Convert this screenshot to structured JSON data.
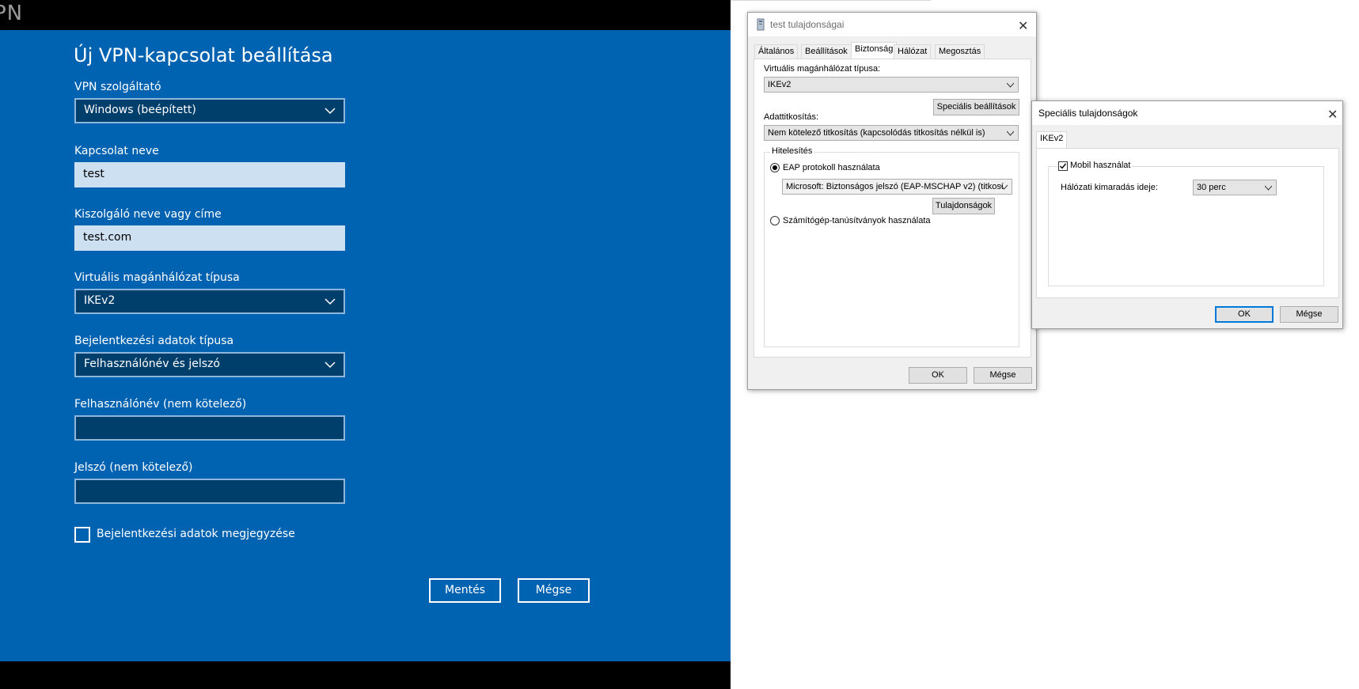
{
  "vpn": {
    "top_label": "PN",
    "title": "Új VPN-kapcsolat beállítása",
    "provider_label": "VPN szolgáltató",
    "provider_value": "Windows (beépített)",
    "connection_name_label": "Kapcsolat neve",
    "connection_name_value": "test",
    "server_label": "Kiszolgáló neve vagy címe",
    "server_value": "test.com",
    "vpn_type_label": "Virtuális magánhálózat típusa",
    "vpn_type_value": "IKEv2",
    "signin_type_label": "Bejelentkezési adatok típusa",
    "signin_type_value": "Felhasználónév és jelszó",
    "username_label": "Felhasználónév (nem kötelező)",
    "username_value": "",
    "password_label": "Jelszó (nem kötelező)",
    "password_value": "",
    "remember_label": "Bejelentkezési adatok megjegyzése",
    "remember_checked": false,
    "save_label": "Mentés",
    "cancel_label": "Mégse"
  },
  "props": {
    "title": "test tulajdonságai",
    "close_glyph": "✕",
    "tabs": [
      "Általános",
      "Beállítások",
      "Biztonság",
      "Hálózat",
      "Megosztás"
    ],
    "active_tab": "Biztonság",
    "vpn_type_label": "Virtuális magánhálózat típusa:",
    "vpn_type_value": "IKEv2",
    "advanced_button": "Speciális beállítások",
    "encryption_label": "Adattitkosítás:",
    "encryption_value": "Nem kötelező titkosítás (kapcsolódás titkosítás nélkül is)",
    "auth_group_label": "Hitelesítés",
    "eap_radio_label": "EAP protokoll használata",
    "eap_method_value": "Microsoft: Biztonságos jelszó (EAP-MSCHAP v2) (titkosí",
    "properties_button": "Tulajdonságok",
    "cert_radio_label": "Számítógép-tanúsítványok használata",
    "ok_label": "OK",
    "cancel_label": "Mégse"
  },
  "advanced": {
    "title": "Speciális tulajdonságok",
    "close_glyph": "✕",
    "tab": "IKEv2",
    "mobility_label": "Mobil használat",
    "mobility_checked": true,
    "timeout_label": "Hálózati kimaradás ideje:",
    "timeout_value": "30 perc",
    "ok_label": "OK",
    "cancel_label": "Mégse"
  },
  "colors": {
    "vpn_blue": "#0063b1",
    "vpn_dark_field": "#003e6c",
    "accent_blue": "#0078d7"
  }
}
